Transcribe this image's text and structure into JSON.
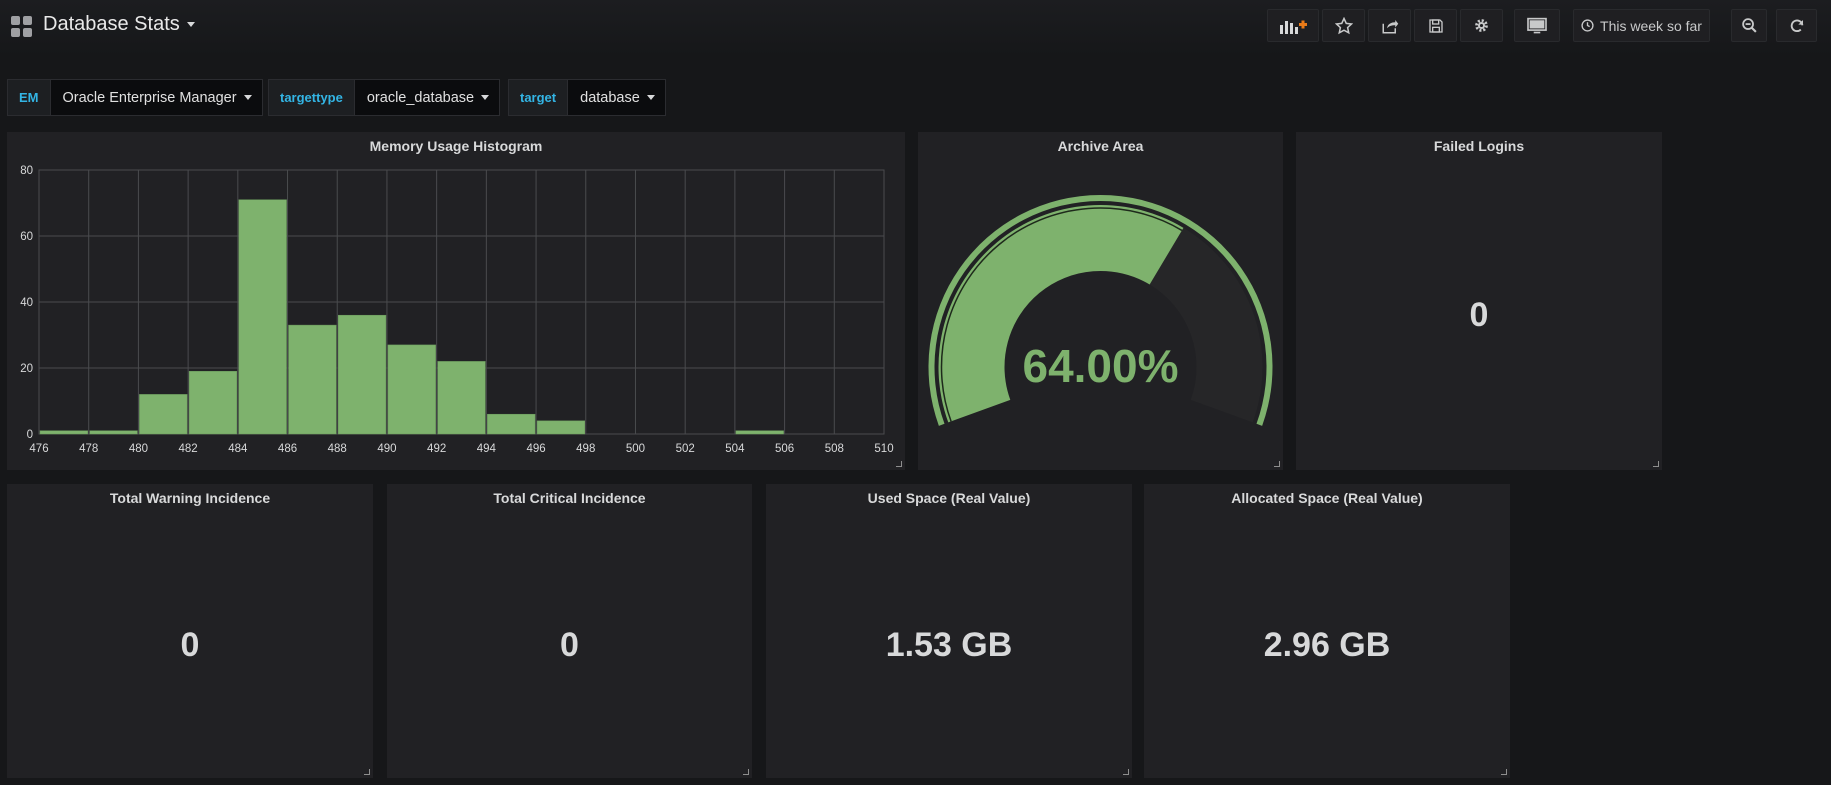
{
  "header": {
    "title": "Database Stats",
    "time_range": "This week so far"
  },
  "variables": [
    {
      "label": "EM",
      "value": "Oracle Enterprise Manager"
    },
    {
      "label": "targettype",
      "value": "oracle_database"
    },
    {
      "label": "target",
      "value": "database"
    }
  ],
  "panels": {
    "memory_histogram": {
      "title": "Memory Usage Histogram"
    },
    "archive_area": {
      "title": "Archive Area",
      "value": "64.00%",
      "fraction": 0.64
    },
    "failed_logins": {
      "title": "Failed Logins",
      "value": "0"
    },
    "total_warning": {
      "title": "Total Warning Incidence",
      "value": "0"
    },
    "total_critical": {
      "title": "Total Critical Incidence",
      "value": "0"
    },
    "used_space": {
      "title": "Used Space (Real Value)",
      "value": "1.53 GB"
    },
    "allocated_space": {
      "title": "Allocated Space (Real Value)",
      "value": "2.96 GB"
    }
  },
  "colors": {
    "accent_green": "#7eb26d",
    "variable_label": "#33b5e5",
    "panel_bg": "#212124",
    "page_bg": "#161719"
  },
  "chart_data": {
    "type": "bar",
    "title": "Memory Usage Histogram",
    "x": [
      476,
      478,
      480,
      482,
      484,
      486,
      488,
      490,
      492,
      494,
      496,
      498,
      500,
      502,
      504,
      506,
      508
    ],
    "values": [
      1,
      1,
      12,
      19,
      71,
      33,
      36,
      27,
      22,
      6,
      4,
      0,
      0,
      0,
      1,
      0,
      0
    ],
    "x_ticks": [
      "476",
      "478",
      "480",
      "482",
      "484",
      "486",
      "488",
      "490",
      "492",
      "494",
      "496",
      "498",
      "500",
      "502",
      "504",
      "506",
      "508",
      "510"
    ],
    "y_ticks": [
      "0",
      "20",
      "40",
      "60",
      "80"
    ],
    "xlim": [
      476,
      510
    ],
    "ylim": [
      0,
      80
    ],
    "grid": true,
    "color": "#7eb26d"
  }
}
